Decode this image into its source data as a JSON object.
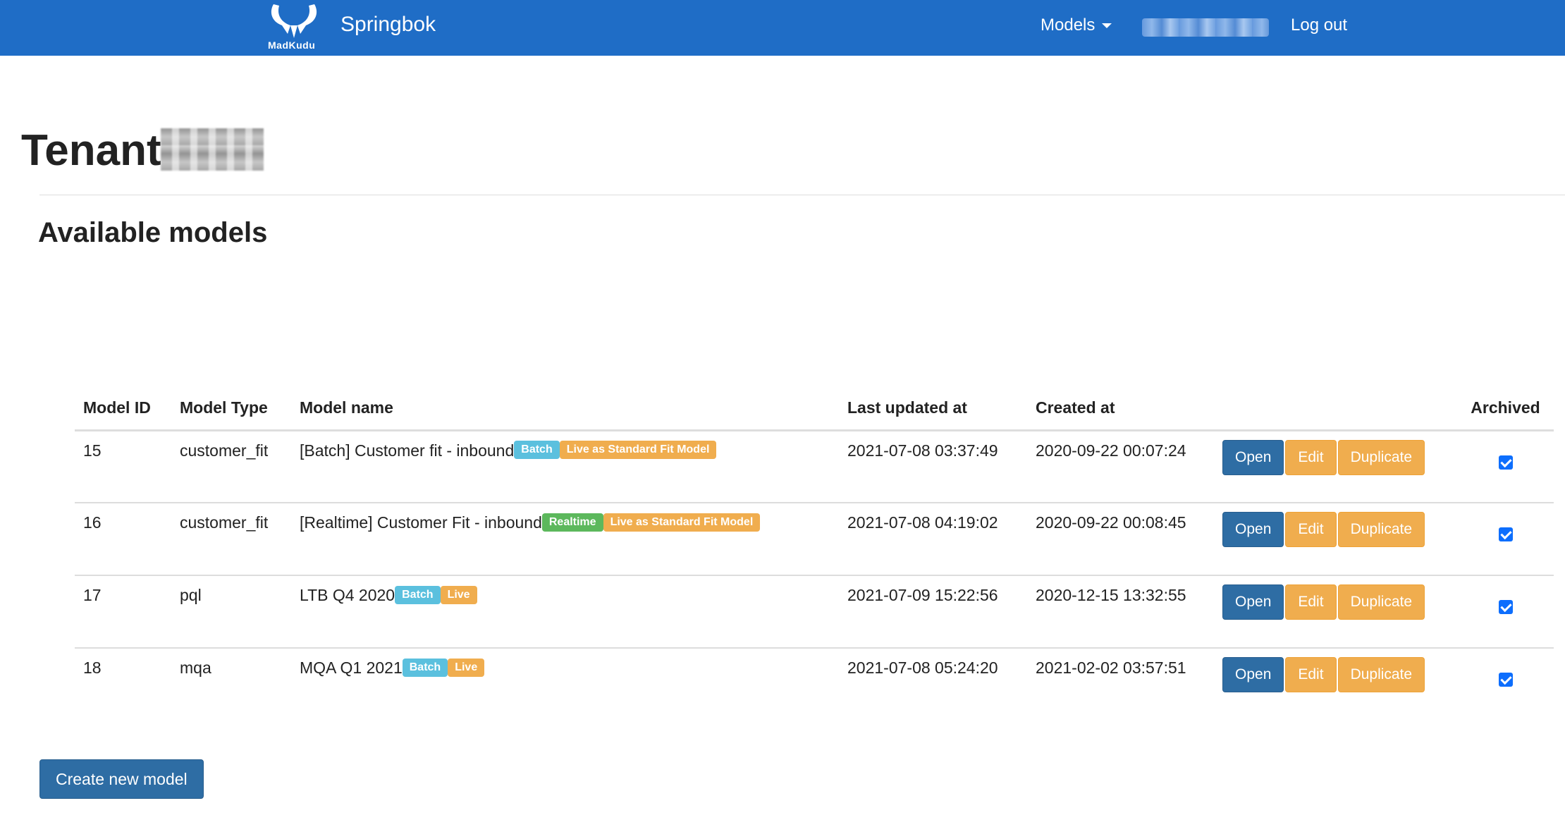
{
  "navbar": {
    "logo_text": "MadKudu",
    "brand": "Springbok",
    "models_menu": "Models",
    "logout": "Log out"
  },
  "header": {
    "title": "Tenant",
    "section_title": "Available models"
  },
  "table": {
    "headers": {
      "id": "Model ID",
      "type": "Model Type",
      "name": "Model name",
      "updated": "Last updated at",
      "created": "Created at",
      "archived": "Archived"
    },
    "rows": [
      {
        "id": "15",
        "type": "customer_fit",
        "name": "[Batch] Customer fit - inbound",
        "badge_mode": "Batch",
        "badge_status": "Live as Standard Fit Model",
        "updated": "2021-07-08 03:37:49",
        "created": "2020-09-22 00:07:24",
        "archived": true
      },
      {
        "id": "16",
        "type": "customer_fit",
        "name": "[Realtime] Customer Fit - inbound",
        "badge_mode": "Realtime",
        "badge_status": "Live as Standard Fit Model",
        "updated": "2021-07-08 04:19:02",
        "created": "2020-09-22 00:08:45",
        "archived": true
      },
      {
        "id": "17",
        "type": "pql",
        "name": "LTB Q4 2020",
        "badge_mode": "Batch",
        "badge_status": "Live",
        "updated": "2021-07-09 15:22:56",
        "created": "2020-12-15 13:32:55",
        "archived": true
      },
      {
        "id": "18",
        "type": "mqa",
        "name": "MQA Q1 2021",
        "badge_mode": "Batch",
        "badge_status": "Live",
        "updated": "2021-07-08 05:24:20",
        "created": "2021-02-02 03:57:51",
        "archived": true
      }
    ],
    "actions": {
      "open": "Open",
      "edit": "Edit",
      "duplicate": "Duplicate"
    }
  },
  "create_button": "Create new model",
  "colors": {
    "navbar": "#1f6dc6",
    "primary": "#2e6da4",
    "warning": "#f0ad4e",
    "info": "#5bc0de",
    "success": "#5cb85c"
  },
  "icons": {
    "logo": "madkudu-horns-logo",
    "models_caret": "chevron-down-icon",
    "archived": "checkbox-checked-icon"
  }
}
